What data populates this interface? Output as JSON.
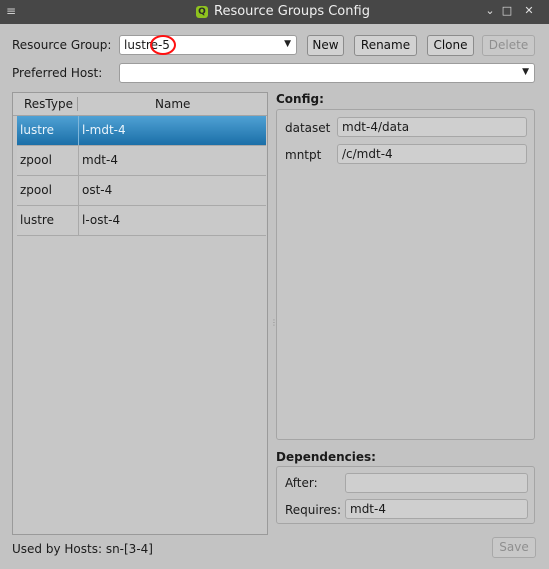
{
  "window": {
    "title": "Resource Groups Config",
    "menu_glyph": "≡",
    "app_icon_letter": "Q",
    "controls": [
      "⌄",
      "□",
      "✕"
    ]
  },
  "resource_group": {
    "label": "Resource Group:",
    "value": "lustre-5",
    "buttons": {
      "new": "New",
      "rename": "Rename",
      "clone": "Clone",
      "delete": "Delete"
    }
  },
  "preferred_host": {
    "label": "Preferred Host:",
    "value": ""
  },
  "table": {
    "headers": [
      "ResType",
      "Name"
    ],
    "rows": [
      {
        "restype": "lustre",
        "name": "l-mdt-4",
        "selected": true
      },
      {
        "restype": "zpool",
        "name": "mdt-4",
        "selected": false
      },
      {
        "restype": "zpool",
        "name": "ost-4",
        "selected": false
      },
      {
        "restype": "lustre",
        "name": "l-ost-4",
        "selected": false
      }
    ]
  },
  "config": {
    "title": "Config:",
    "fields": [
      {
        "key": "dataset",
        "value": "mdt-4/data"
      },
      {
        "key": "mntpt",
        "value": "/c/mdt-4"
      }
    ]
  },
  "dependencies": {
    "title": "Dependencies:",
    "after_label": "After:",
    "after_value": "",
    "requires_label": "Requires:",
    "requires_value": "mdt-4"
  },
  "status": {
    "used_by_hosts": "Used by Hosts: sn-[3-4]"
  },
  "save_label": "Save",
  "colors": {
    "selection": "#1b6fa8",
    "titlebar": "#474747",
    "window_bg": "#c3c3c3",
    "annotation_circle": "#ff1010"
  }
}
